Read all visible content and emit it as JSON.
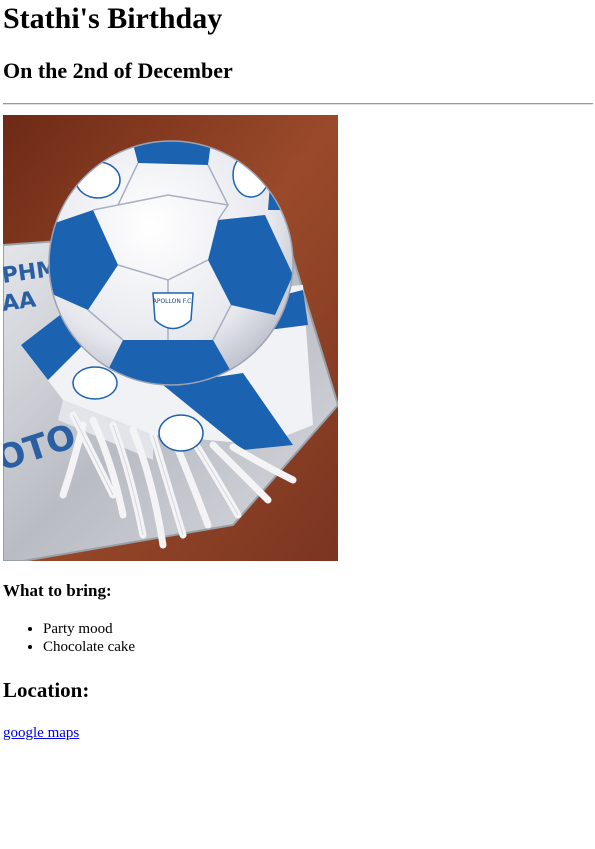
{
  "page": {
    "title": "Stathi's Birthday",
    "subtitle": "On the 2nd of December"
  },
  "image": {
    "icon": "soccer-ball-cake-image",
    "colors": {
      "ball_white": "#f2f2f4",
      "ball_blue": "#1b62b0",
      "board_silver": "#c9ccd2",
      "table_wood": "#8a3d22"
    },
    "cake_text_lines": [
      "ΡΗΜΙΑ",
      "ΑΑ",
      "ΟΤΟ"
    ],
    "logo_text": "APOLLON F.C."
  },
  "bring": {
    "heading": "What to bring:",
    "items": [
      "Party mood",
      "Chocolate cake"
    ]
  },
  "location": {
    "heading": "Location:",
    "link_text": "google maps"
  }
}
